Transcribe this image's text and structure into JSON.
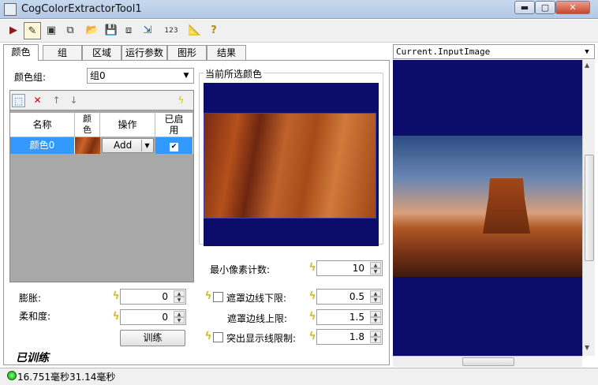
{
  "window": {
    "title": "CogColorExtractorTool1",
    "min": "▬",
    "max": "▢",
    "close": "✕"
  },
  "toolbar": {
    "items": [
      "run-icon",
      "pencil-icon",
      "display-icon",
      "export-icon",
      "open-icon",
      "save-icon",
      "copy-icon",
      "import-icon",
      "counter-icon",
      "measure-icon",
      "help-icon"
    ]
  },
  "tabs": [
    "颜色",
    "组",
    "区域",
    "运行参数",
    "图形",
    "结果"
  ],
  "color_tab": {
    "group_label": "颜色组:",
    "group_value": "组0",
    "table": {
      "headers": [
        "名称",
        "颜色",
        "操作",
        "已启用"
      ],
      "rows": [
        {
          "name": "颜色0",
          "action": "Add",
          "enabled": "✔"
        }
      ]
    },
    "dilate_label": "膨胀:",
    "dilate_value": "0",
    "softness_label": "柔和度:",
    "softness_value": "0",
    "train_button": "训练",
    "trained_status": "已训练"
  },
  "preview": {
    "title": "当前所选颜色"
  },
  "params": {
    "min_pixel_label": "最小像素计数:",
    "min_pixel_value": "10",
    "mask_lower_label": "遮罩边线下限:",
    "mask_lower_value": "0.5",
    "mask_upper_label": "遮罩边线上限:",
    "mask_upper_value": "1.5",
    "highlight_label": "突出显示线限制:",
    "highlight_value": "1.8"
  },
  "image_pane": {
    "selector": "Current.InputImage"
  },
  "status": {
    "text": "16.751毫秒31.14毫秒"
  }
}
